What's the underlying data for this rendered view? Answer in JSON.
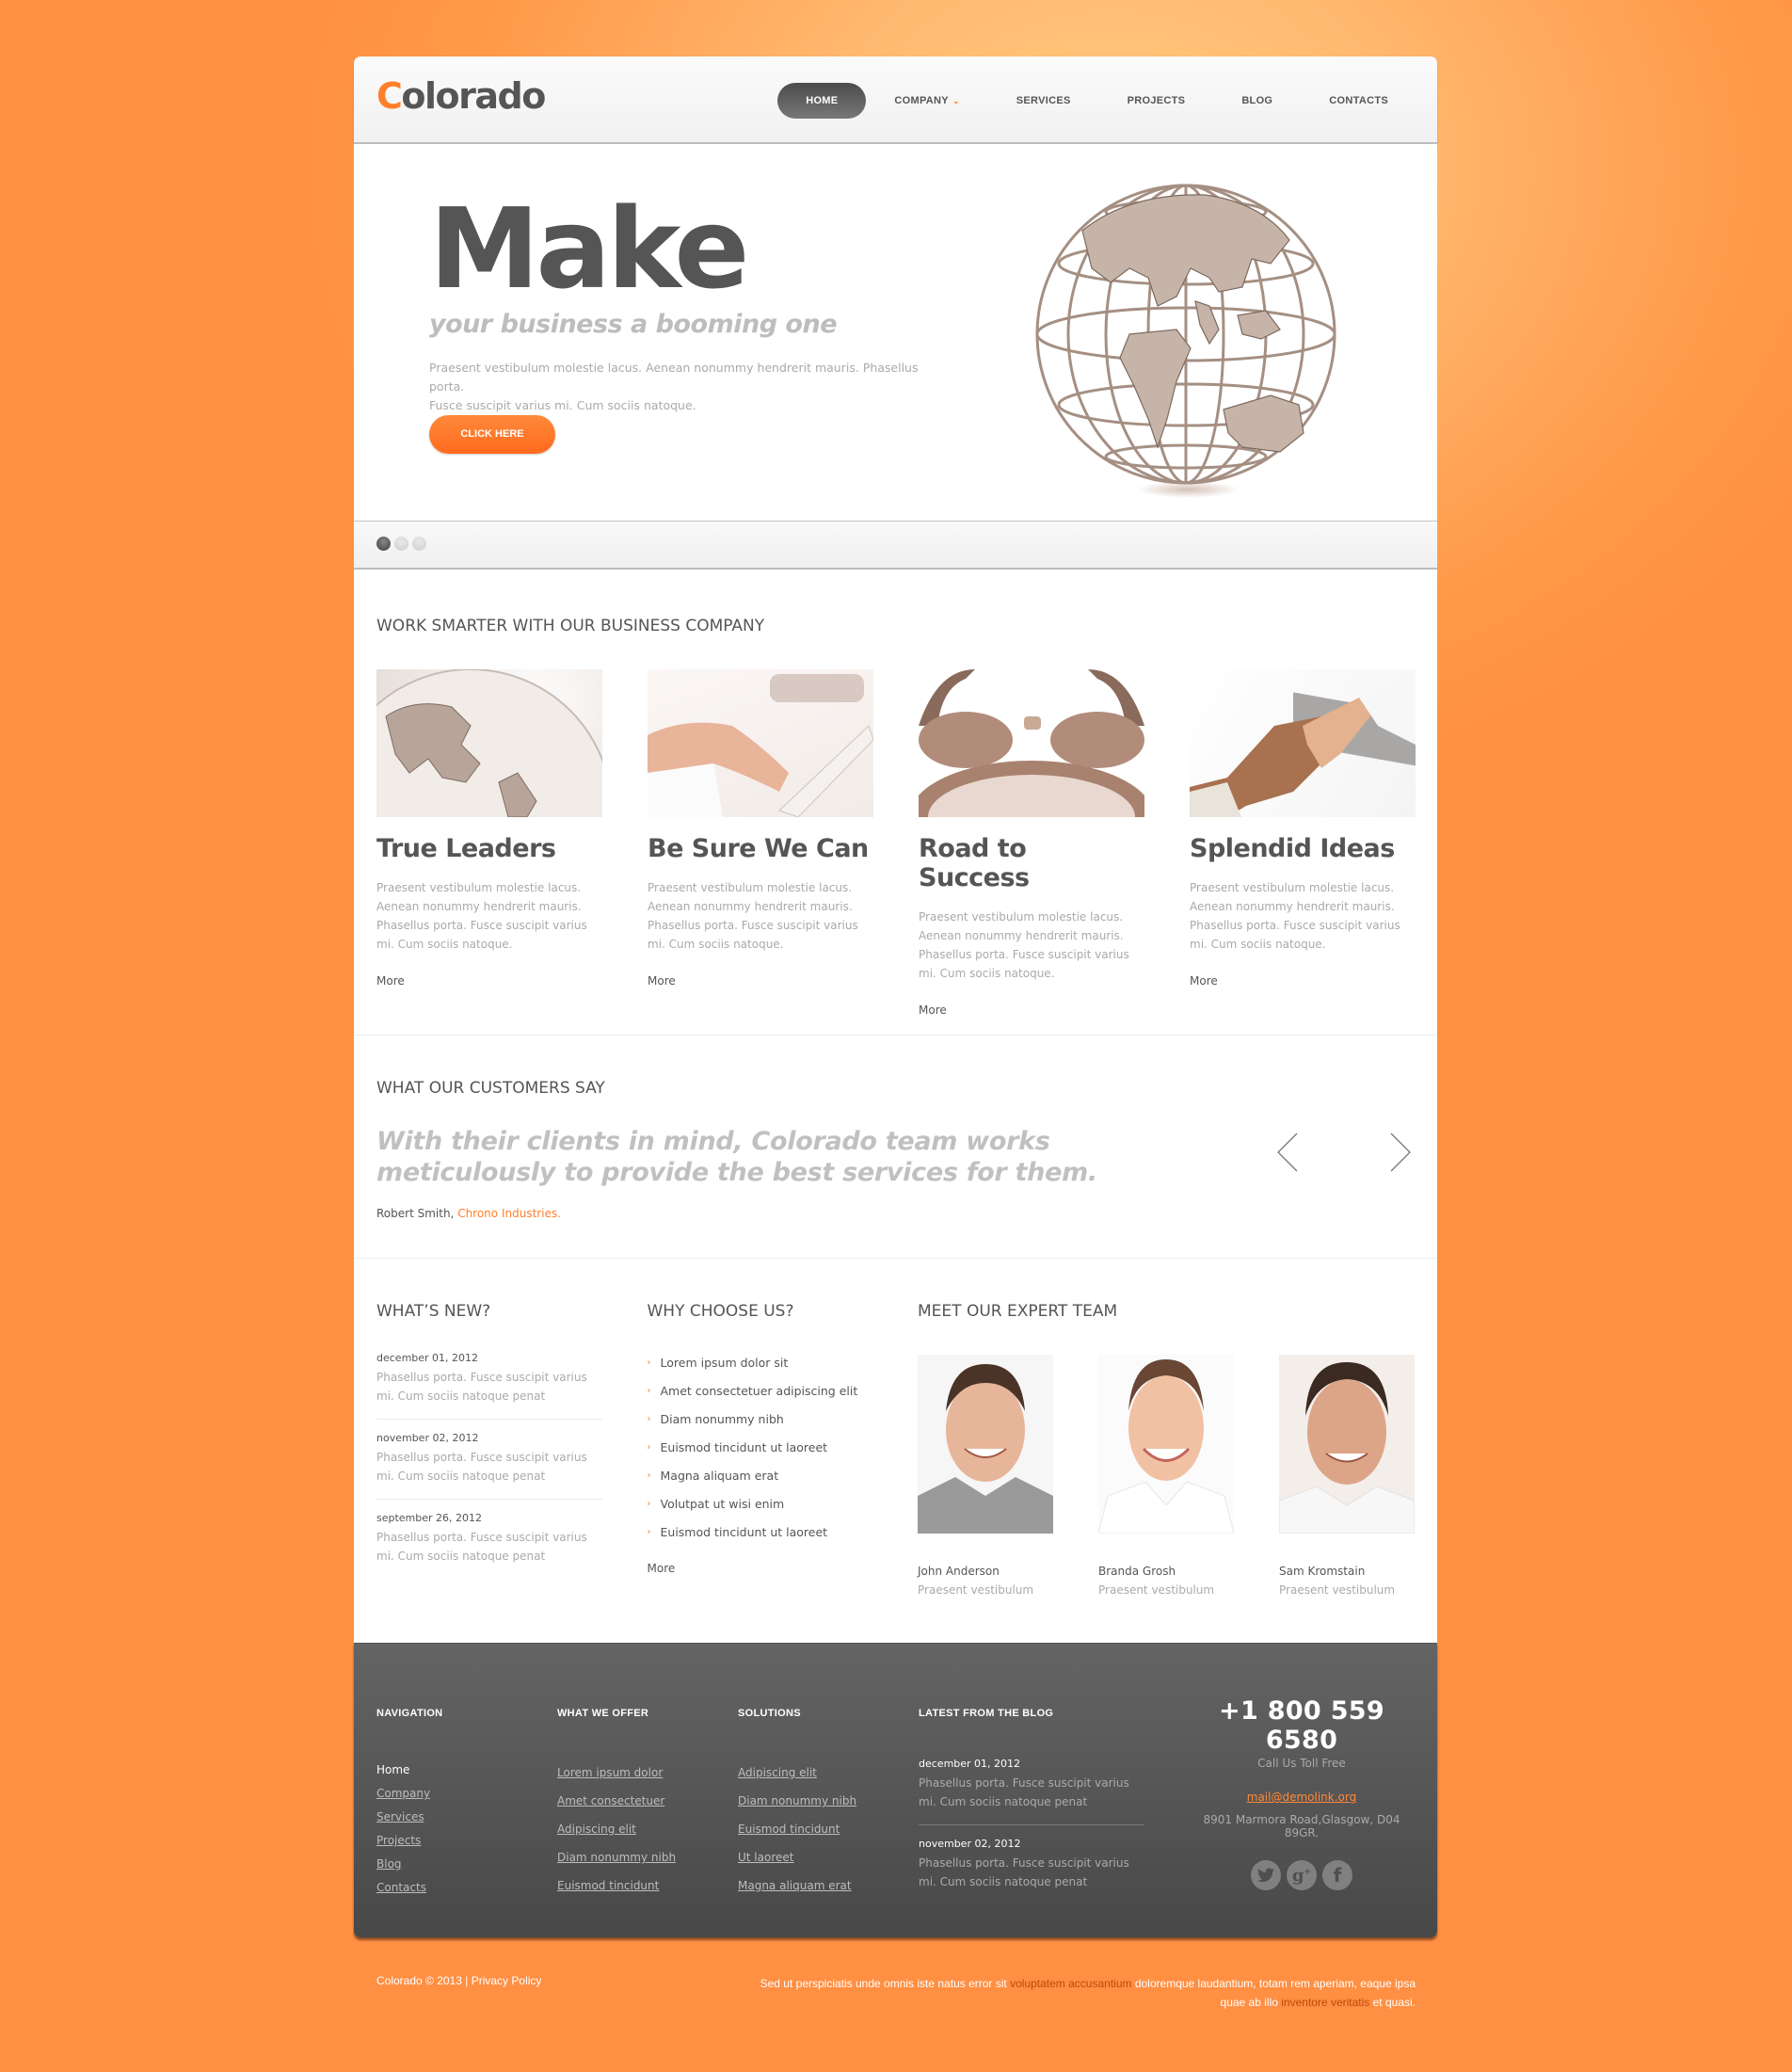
{
  "header": {
    "logo_first": "C",
    "logo_rest": "olorado",
    "nav": [
      {
        "label": "HOME",
        "active": true
      },
      {
        "label": "COMPANY",
        "dropdown": true
      },
      {
        "label": "SERVICES"
      },
      {
        "label": "PROJECTS"
      },
      {
        "label": "BLOG"
      },
      {
        "label": "CONTACTS"
      }
    ],
    "caret_icon": "chevron-down-icon"
  },
  "hero": {
    "title": "Make",
    "subtitle": "your business a booming one",
    "text_line1": "Praesent vestibulum molestie lacus. Aenean nonummy hendrerit mauris. Phasellus porta.",
    "text_line2": "Fusce suscipit varius mi. Cum sociis natoque.",
    "button": "CLICK HERE",
    "image": "wireframe-globe-image",
    "slides_total": 3,
    "slide_active": 1
  },
  "features": {
    "title": "WORK SMARTER WITH OUR BUSINESS COMPANY",
    "cards": [
      {
        "image": "globe-europe-image",
        "title": "True Leaders",
        "text": "Praesent vestibulum molestie lacus. Aenean nonummy hendrerit mauris. Phasellus porta. Fusce suscipit varius mi. Cum sociis natoque.",
        "more": "More"
      },
      {
        "image": "typing-keyboard-image",
        "title": "Be Sure We Can",
        "text": "Praesent vestibulum molestie lacus. Aenean nonummy hendrerit mauris. Phasellus porta. Fusce suscipit varius mi. Cum sociis natoque.",
        "more": "More"
      },
      {
        "image": "alarm-clock-image",
        "title": "Road to Success",
        "text": "Praesent vestibulum molestie lacus. Aenean nonummy hendrerit mauris. Phasellus porta. Fusce suscipit varius mi. Cum sociis natoque.",
        "more": "More"
      },
      {
        "image": "handshake-image",
        "title": "Splendid Ideas",
        "text": "Praesent vestibulum molestie lacus. Aenean nonummy hendrerit mauris. Phasellus porta. Fusce suscipit varius mi. Cum sociis natoque.",
        "more": "More"
      }
    ]
  },
  "testimonials": {
    "title": "WHAT OUR CUSTOMERS SAY",
    "quote": "With their clients in mind, Colorado team works meticulously to provide the best services for them.",
    "author": "Robert Smith,",
    "company": "Chrono Industries."
  },
  "whats_new": {
    "title": "WHAT’S NEW?",
    "items": [
      {
        "date": "december 01, 2012",
        "text": "Phasellus porta. Fusce suscipit varius mi. Cum sociis natoque penat"
      },
      {
        "date": "november 02, 2012",
        "text": "Phasellus porta. Fusce suscipit varius mi. Cum sociis natoque penat"
      },
      {
        "date": "september 26, 2012",
        "text": "Phasellus porta. Fusce suscipit varius mi. Cum sociis natoque penat"
      }
    ]
  },
  "why_choose": {
    "title": "WHY CHOOSE US?",
    "items": [
      "Lorem ipsum dolor sit",
      "Amet consectetuer adipiscing elit",
      "Diam nonummy nibh",
      "Euismod tincidunt ut laoreet",
      "Magna aliquam erat",
      "Volutpat ut wisi enim",
      "Euismod tincidunt ut laoreet"
    ],
    "more": "More"
  },
  "team": {
    "title": "MEET OUR EXPERT TEAM",
    "members": [
      {
        "name": "John Anderson",
        "role": "Praesent vestibulum"
      },
      {
        "name": "Branda Grosh",
        "role": "Praesent vestibulum"
      },
      {
        "name": "Sam Kromstain",
        "role": "Praesent vestibulum"
      }
    ]
  },
  "footer": {
    "navigation": {
      "title": "NAVIGATION",
      "links": [
        "Home",
        "Company",
        "Services",
        "Projects",
        "Blog",
        "Contacts"
      ]
    },
    "offer": {
      "title": "WHAT WE OFFER",
      "links": [
        "Lorem ipsum dolor",
        "Amet consectetuer",
        "Adipiscing elit",
        "Diam nonummy nibh",
        "Euismod tincidunt"
      ]
    },
    "solutions": {
      "title": "SOLUTIONS",
      "links": [
        "Adipiscing elit",
        "Diam nonummy nibh",
        "Euismod tincidunt",
        "Ut laoreet",
        "Magna aliquam erat"
      ]
    },
    "blog": {
      "title": "LATEST FROM THE BLOG",
      "items": [
        {
          "date": "december 01, 2012",
          "text": "Phasellus porta. Fusce suscipit varius mi. Cum sociis natoque penat"
        },
        {
          "date": "november 02, 2012",
          "text": "Phasellus porta. Fusce suscipit varius mi. Cum sociis natoque penat"
        }
      ]
    },
    "contact": {
      "phone": "+1 800 559 6580",
      "phone_label": "Call Us Toll Free",
      "email": "mail@demolink.org",
      "address": "8901 Marmora Road,Glasgow, D04 89GR.",
      "socials": [
        "twitter-icon",
        "google-plus-icon",
        "facebook-icon"
      ]
    }
  },
  "bottom": {
    "copyright": "Colorado © 2013",
    "separator": "|",
    "privacy": "Privacy Policy",
    "tagline_part1": "Sed ut perspiciatis unde omnis iste natus error sit ",
    "tagline_hl1": "voluptatem accusantium",
    "tagline_part2": " doloremque laudantium, totam rem aperiam, eaque ipsa quae ab illo ",
    "tagline_hl2": "inventore veritatis",
    "tagline_part3": " et quasi."
  },
  "colors": {
    "accent": "#ff7f2a",
    "text_dark": "#555555",
    "text_light": "#aaaaaa",
    "footer_bg": "#555555",
    "page_bg": "#ff9a4a"
  }
}
